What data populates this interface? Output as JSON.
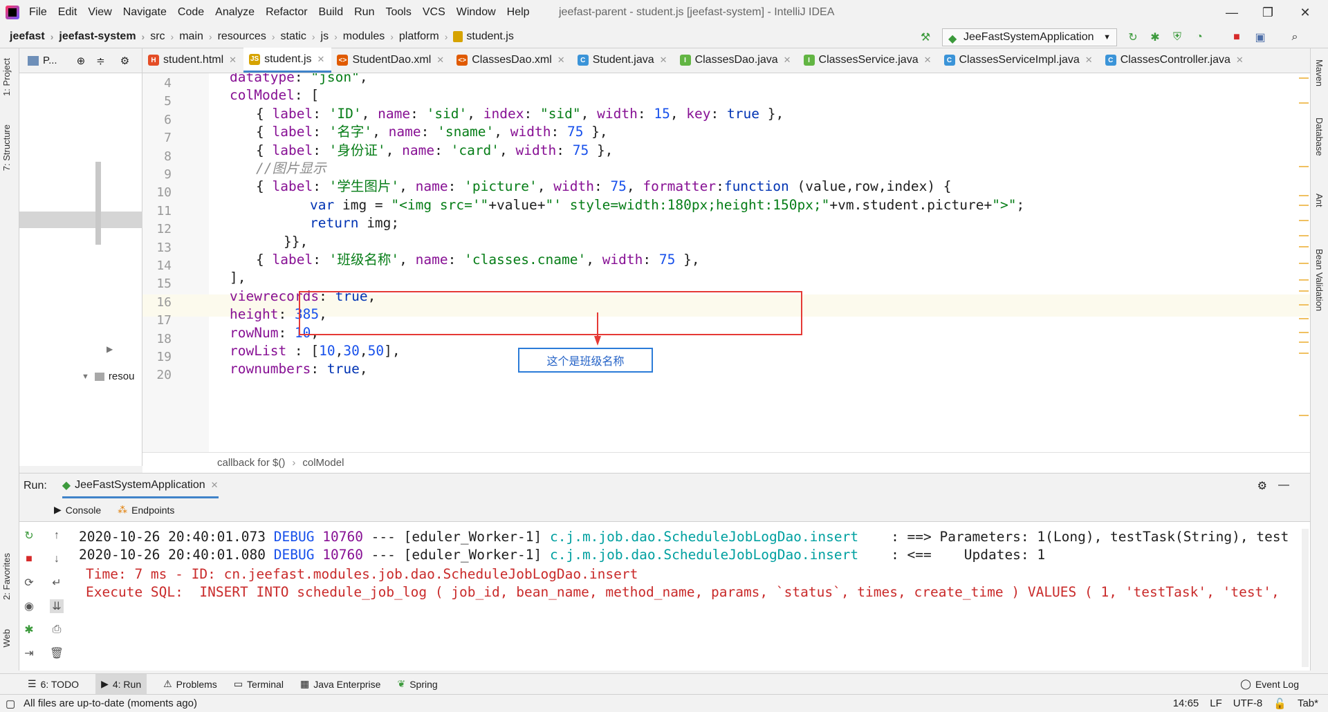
{
  "window": {
    "title": "jeefast-parent - student.js [jeefast-system] - IntelliJ IDEA",
    "controls": [
      "—",
      "❐",
      "✕"
    ]
  },
  "menu": [
    "File",
    "Edit",
    "View",
    "Navigate",
    "Code",
    "Analyze",
    "Refactor",
    "Build",
    "Run",
    "Tools",
    "VCS",
    "Window",
    "Help"
  ],
  "breadcrumbs": [
    "jeefast",
    "jeefast-system",
    "src",
    "main",
    "resources",
    "static",
    "js",
    "modules",
    "platform",
    "student.js"
  ],
  "run_config": "JeeFastSystemApplication",
  "left_tabs": [
    "1: Project",
    "7: Structure",
    "2: Favorites",
    "Web"
  ],
  "right_tabs": [
    "Maven",
    "Database",
    "Ant",
    "Bean Validation"
  ],
  "project_panel": {
    "title": "P...",
    "tree_item": "resou"
  },
  "editor_tabs": [
    {
      "label": "student.html",
      "icon": "html-file-icon",
      "color": "#e44d26",
      "glyph": "H"
    },
    {
      "label": "student.js",
      "icon": "js-file-icon",
      "color": "#d6a300",
      "glyph": "JS",
      "active": true
    },
    {
      "label": "StudentDao.xml",
      "icon": "xml-file-icon",
      "color": "#e05a00",
      "glyph": "<>"
    },
    {
      "label": "ClassesDao.xml",
      "icon": "xml-file-icon",
      "color": "#e05a00",
      "glyph": "<>"
    },
    {
      "label": "Student.java",
      "icon": "class-icon",
      "color": "#3b94d8",
      "glyph": "C"
    },
    {
      "label": "ClassesDao.java",
      "icon": "interface-icon",
      "color": "#62b543",
      "glyph": "I"
    },
    {
      "label": "ClassesService.java",
      "icon": "interface-icon",
      "color": "#62b543",
      "glyph": "I"
    },
    {
      "label": "ClassesServiceImpl.java",
      "icon": "class-icon",
      "color": "#3b94d8",
      "glyph": "C"
    },
    {
      "label": "ClassesController.java",
      "icon": "class-icon",
      "color": "#3b94d8",
      "glyph": "C"
    }
  ],
  "line_numbers": [
    "4",
    "5",
    "6",
    "7",
    "8",
    "9",
    "10",
    "11",
    "12",
    "13",
    "14",
    "15",
    "16",
    "17",
    "18",
    "19",
    "20"
  ],
  "code_lines": [
    "datatype: \"json\",",
    "colModel: [",
    "{ label: 'ID', name: 'sid', index: \"sid\", width: 15, key: true },",
    "{ label: '名字', name: 'sname', width: 75 },",
    "{ label: '身份证', name: 'card', width: 75 },",
    "//图片显示",
    "{ label: '学生图片', name: 'picture', width: 75, formatter:function (value,row,index) {",
    "var img = \"<img src='\"+value+\"' style=width:180px;height:150px;\"+vm.student.picture+\">\";",
    "return img;",
    "}},",
    "{ label: '班级名称', name: 'classes.cname', width: 75 },",
    "],",
    "viewrecords: true,",
    "height: 385,",
    "rowNum: 10,",
    "rowList : [10,30,50],",
    "rownumbers: true,"
  ],
  "annotation": "这个是班级名称",
  "editor_breadcrumb": [
    "callback for $()",
    "colModel"
  ],
  "run_panel": {
    "label": "Run:",
    "config": "JeeFastSystemApplication",
    "subtabs": [
      "Console",
      "Endpoints"
    ]
  },
  "console_lines": [
    {
      "ts": "2020-10-26 20:40:01.073",
      "level": "DEBUG",
      "pid": "10760",
      "sep": " --- ",
      "thread": "[eduler_Worker-1]",
      "logger": "c.j.m.job.dao.ScheduleJobLogDao.insert",
      "msg": "   : ==> Parameters: 1(Long), testTask(String), test"
    },
    {
      "ts": "2020-10-26 20:40:01.080",
      "level": "DEBUG",
      "pid": "10760",
      "sep": " --- ",
      "thread": "[eduler_Worker-1]",
      "logger": "c.j.m.job.dao.ScheduleJobLogDao.insert",
      "msg": "   : <==    Updates: 1"
    }
  ],
  "console_red": [
    "Time: 7 ms - ID: cn.jeefast.modules.job.dao.ScheduleJobLogDao.insert",
    "Execute SQL:  INSERT INTO schedule_job_log ( job_id, bean_name, method_name, params, `status`, times, create_time ) VALUES ( 1, 'testTask', 'test',"
  ],
  "bottom_tabs": [
    "6: TODO",
    "4: Run",
    "Problems",
    "Terminal",
    "Java Enterprise",
    "Spring"
  ],
  "event_log": "Event Log",
  "status": {
    "message": "All files are up-to-date (moments ago)",
    "position": "14:65",
    "line_sep": "LF",
    "encoding": "UTF-8",
    "indent": "Tab*"
  }
}
